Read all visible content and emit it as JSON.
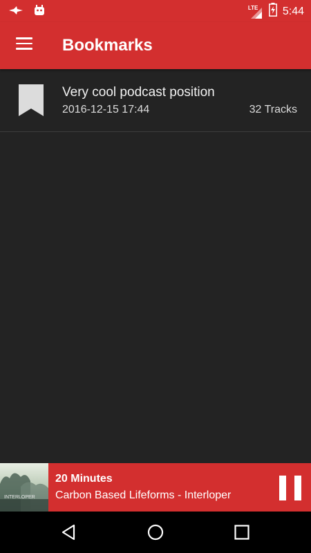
{
  "status_bar": {
    "time": "5:44",
    "network": "LTE",
    "icons": [
      "notification-icon",
      "android-icon",
      "signal-icon",
      "battery-icon"
    ]
  },
  "app_bar": {
    "title": "Bookmarks",
    "menu_icon": "menu-icon"
  },
  "bookmarks": [
    {
      "title": "Very cool podcast position",
      "date": "2016-12-15 17:44",
      "tracks": "32 Tracks",
      "icon": "bookmark-icon"
    }
  ],
  "now_playing": {
    "title": "20 Minutes",
    "subtitle": "Carbon Based Lifeforms - Interloper",
    "art_text": "INTERLOPER",
    "control_icon": "pause-icon"
  },
  "nav": {
    "icons": [
      "back-icon",
      "home-icon",
      "recents-icon"
    ]
  },
  "colors": {
    "accent": "#d32f2f",
    "background": "#232323",
    "divider": "#3d3d3d"
  }
}
